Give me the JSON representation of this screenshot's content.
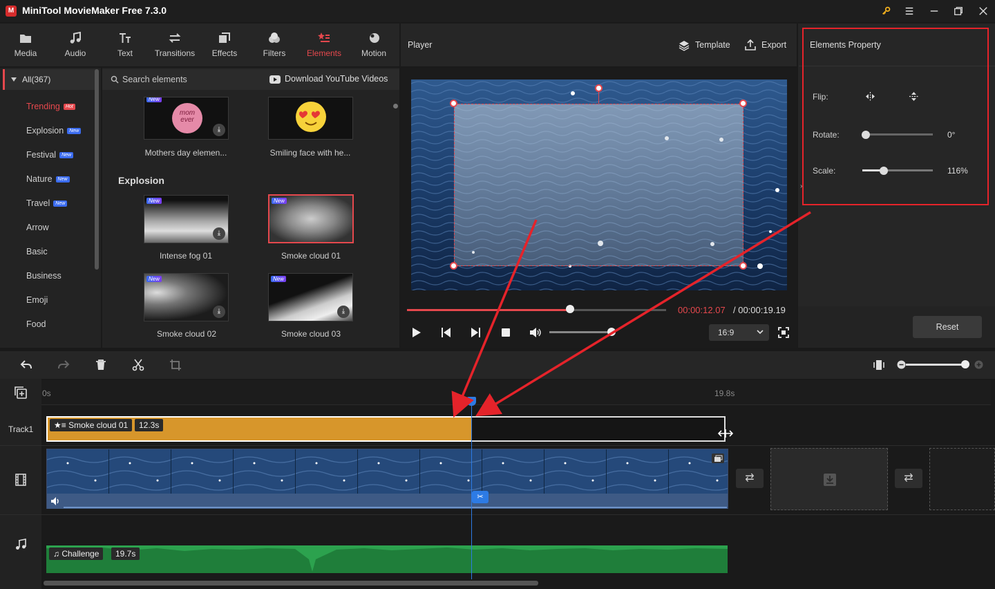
{
  "window": {
    "title": "MiniTool MovieMaker Free 7.3.0",
    "logo_letter": "M"
  },
  "nav": [
    {
      "label": "Media",
      "icon": "folder-icon"
    },
    {
      "label": "Audio",
      "icon": "music-note-icon"
    },
    {
      "label": "Text",
      "icon": "text-icon"
    },
    {
      "label": "Transitions",
      "icon": "transitions-icon"
    },
    {
      "label": "Effects",
      "icon": "effects-icon"
    },
    {
      "label": "Filters",
      "icon": "filters-icon"
    },
    {
      "label": "Elements",
      "icon": "elements-icon",
      "active": true
    },
    {
      "label": "Motion",
      "icon": "motion-icon"
    }
  ],
  "categories": {
    "all": "All(367)",
    "items": [
      {
        "label": "Trending",
        "badge": "Hot",
        "active": true
      },
      {
        "label": "Explosion",
        "badge": "New"
      },
      {
        "label": "Festival",
        "badge": "New"
      },
      {
        "label": "Nature",
        "badge": "New"
      },
      {
        "label": "Travel",
        "badge": "New"
      },
      {
        "label": "Arrow"
      },
      {
        "label": "Basic"
      },
      {
        "label": "Business"
      },
      {
        "label": "Emoji"
      },
      {
        "label": "Food"
      }
    ]
  },
  "elements": {
    "search_placeholder": "Search elements",
    "download_link": "Download YouTube Videos",
    "new_tag": "New",
    "section": "Explosion",
    "top_items": [
      "Mothers day elemen...",
      "Smiling face with he..."
    ],
    "items": [
      "Intense fog 01",
      "Smoke cloud 01",
      "Smoke cloud 02",
      "Smoke cloud 03"
    ],
    "mothers_text": "mom ever"
  },
  "player": {
    "label": "Player",
    "template": "Template",
    "export": "Export",
    "time_current": "00:00:12.07",
    "time_total": " / 00:00:19.19",
    "progress": 0.63,
    "volume": 0.95,
    "ratio": "16:9"
  },
  "properties": {
    "title": "Elements Property",
    "flip_label": "Flip:",
    "rotate_label": "Rotate:",
    "rotate_value": "0°",
    "rotate_fraction": 0.0,
    "scale_label": "Scale:",
    "scale_value": "116%",
    "scale_fraction": 0.3,
    "reset": "Reset"
  },
  "timeline": {
    "ruler_start": "0s",
    "ruler_end": "19.8s",
    "track1": "Track1",
    "element_clip": {
      "name": "Smoke cloud 01",
      "duration": "12.3s"
    },
    "audio_clip": {
      "name": "Challenge",
      "duration": "19.7s"
    },
    "zoom": 0.95
  },
  "colors": {
    "accent": "#e5484d",
    "element_clip": "#d7962b",
    "audio_clip": "#2ca24e",
    "playhead": "#2d7be5",
    "annotation": "#e5232a"
  }
}
